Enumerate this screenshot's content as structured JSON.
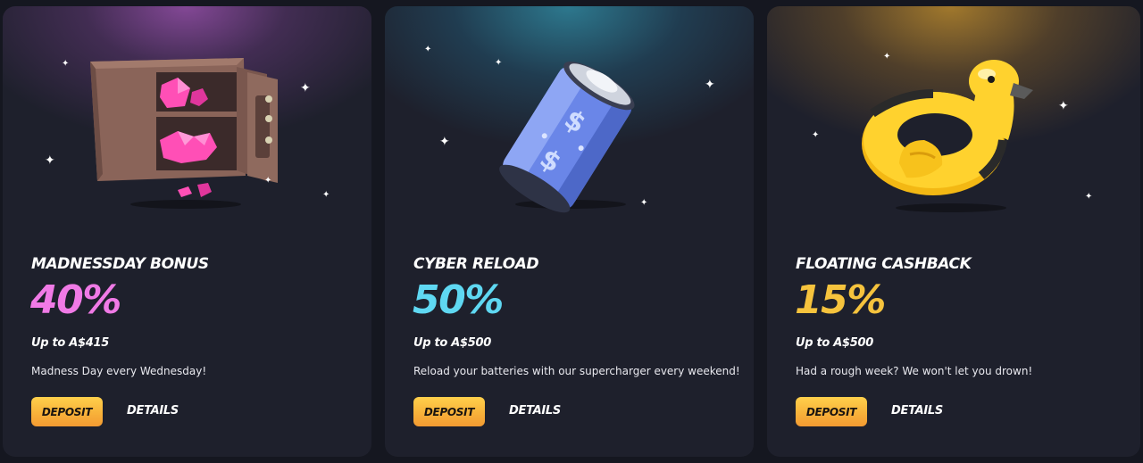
{
  "cards": [
    {
      "title": "MADNESSDAY BONUS",
      "percent": "40%",
      "percent_color": "#f07ae6",
      "limit": "Up to A$415",
      "description": "Madness Day every Wednesday!",
      "deposit_label": "DEPOSIT",
      "details_label": "DETAILS",
      "image": "open-safe-with-gems-icon",
      "glow_color": "#a555b9"
    },
    {
      "title": "CYBER RELOAD",
      "percent": "50%",
      "percent_color": "#5fd8f2",
      "limit": "Up to A$500",
      "description": "Reload your batteries with our supercharger every weekend!",
      "deposit_label": "DEPOSIT",
      "details_label": "DETAILS",
      "image": "battery-dollar-icon",
      "glow_color": "#3296af"
    },
    {
      "title": "FLOATING CASHBACK",
      "percent": "15%",
      "percent_color": "#f6c33d",
      "limit": "Up to A$500",
      "description": "Had a rough week? We won't let you drown!",
      "deposit_label": "DEPOSIT",
      "details_label": "DETAILS",
      "image": "rubber-duck-float-icon",
      "glow_color": "#cd962d"
    }
  ]
}
